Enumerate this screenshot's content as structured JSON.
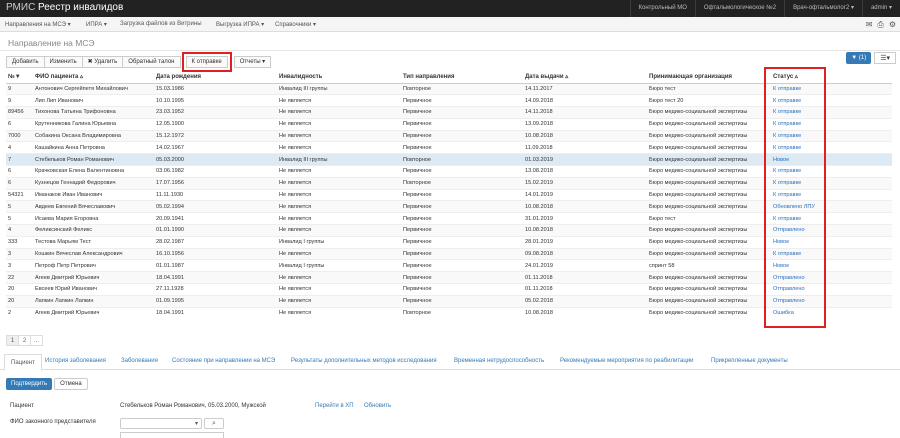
{
  "navbar": {
    "brand": "РМИС",
    "title": "Реестр инвалидов",
    "right_items": [
      "Контрольный МО",
      "Офтальмологическое №2",
      "Врач-офтальмолог2 ▾",
      "admin ▾"
    ]
  },
  "menu": {
    "items": [
      "Направления на МСЭ ▾",
      "ИПРА ▾",
      "Загрузка файлов из Витрины",
      "Выгрузка ИПРА ▾",
      "Справочники ▾"
    ]
  },
  "page_title": "Направление на МСЭ",
  "toolbar": {
    "add": "Добавить",
    "edit": "Изменить",
    "delete": "✖ Удалить",
    "reverse": "Обратный талон",
    "to_send": "К отправке",
    "reports": "Отчеты ▾"
  },
  "filter": {
    "label": "▼ (1)"
  },
  "list_toggle": "☰▾",
  "table": {
    "headers": [
      "№▼",
      "ФИО пациента ▵",
      "Дата рождения",
      "Инвалидность",
      "Тип направления",
      "Дата выдачи ▵",
      "Принимающая организация",
      "Статус ▵"
    ],
    "rows": [
      [
        "9",
        "Антонович Сергейпетя Михайлович",
        "15.03.1986",
        "Инвалид III группы",
        "Повторное",
        "14.11.2017",
        "Бюро тест",
        "К отправке"
      ],
      [
        "9",
        "Лип Лип Иванович",
        "10.10.1995",
        "Не является",
        "Первичное",
        "14.09.2018",
        "Бюро тест 20",
        "К отправке"
      ],
      [
        "89456",
        "Тихонова Татьяна Трифоновна",
        "23.03.1952",
        "Не является",
        "Первичное",
        "14.11.2018",
        "Бюро медико-социальной экспертизы",
        "К отправке"
      ],
      [
        "6",
        "Крутенникова Галина Юрьевна",
        "12.05.1900",
        "Не является",
        "Первичное",
        "13.09.2018",
        "Бюро медико-социальной экспертизы",
        "К отправке"
      ],
      [
        "7000",
        "Собакина Оксана Владимировна",
        "15.12.1972",
        "Не является",
        "Первичное",
        "10.08.2018",
        "Бюро медико-социальной экспертизы",
        "К отправке"
      ],
      [
        "4",
        "Кашайкина Анна Петровна",
        "14.02.1967",
        "Не является",
        "Первичное",
        "11.09.2018",
        "Бюро медико-социальной экспертизы",
        "К отправке"
      ],
      [
        "7",
        "Стебельков Роман Романович",
        "05.03.2000",
        "Инвалид III группы",
        "Повторное",
        "01.03.2019",
        "Бюро медико-социальной экспертизы",
        "Новое"
      ],
      [
        "6",
        "Крачковская Елена Валентиновна",
        "03.06.1982",
        "Не является",
        "Первичное",
        "13.08.2018",
        "Бюро медико-социальной экспертизы",
        "К отправке"
      ],
      [
        "6",
        "Кузнецов Геннадий Федорович",
        "17.07.1956",
        "Не является",
        "Повторное",
        "15.02.2019",
        "Бюро медико-социальной экспертизы",
        "К отправке"
      ],
      [
        "54321",
        "Иманаков Иван Иванович",
        "11.11.1930",
        "Не является",
        "Первичное",
        "14.01.2019",
        "Бюро медико-социальной экспертизы",
        "К отправке"
      ],
      [
        "5",
        "Авдеев Евгений Вячеславович",
        "05.02.1994",
        "Не является",
        "Первичное",
        "10.08.2018",
        "Бюро медико-социальной экспертизы",
        "Обновлено ЛПУ"
      ],
      [
        "5",
        "Исаева Мария Егоровна",
        "20.09.1941",
        "Не является",
        "Первичное",
        "31.01.2019",
        "Бюро тест",
        "К отправке"
      ],
      [
        "4",
        "Феликсинский Феликс",
        "01.01.1990",
        "Не является",
        "Первичное",
        "10.08.2018",
        "Бюро медико-социальной экспертизы",
        "Отправлено"
      ],
      [
        "333",
        "Тестова Марьям Тест",
        "28.02.1987",
        "Инвалид I группы",
        "Первичное",
        "28.01.2019",
        "Бюро медико-социальной экспертизы",
        "Новое"
      ],
      [
        "3",
        "Кошкин Вячеслав Александрович",
        "16.10.1956",
        "Не является",
        "Первичное",
        "09.08.2018",
        "Бюро медико-социальной экспертизы",
        "К отправке"
      ],
      [
        "3",
        "Петроф Петр Петрович",
        "01.01.1987",
        "Инвалид I группы",
        "Первичное",
        "24.01.2019",
        "спринт 58",
        "Новое"
      ],
      [
        "22",
        "Агеев Дмитрий Юрьевич",
        "18.04.1991",
        "Не является",
        "Первичное",
        "01.11.2018",
        "Бюро медико-социальной экспертизы",
        "Отправлено"
      ],
      [
        "20",
        "Евсеев Юрий Иванович",
        "27.11.1928",
        "Не является",
        "Первичное",
        "01.11.2018",
        "Бюро медико-социальной экспертизы",
        "Отправлено"
      ],
      [
        "20",
        "Лапкин Лапкин Лапкин",
        "01.09.1995",
        "Не является",
        "Первичное",
        "05.02.2018",
        "Бюро медико-социальной экспертизы",
        "Отправлено"
      ],
      [
        "2",
        "Агеев Дмитрий Юрьевич",
        "18.04.1991",
        "Не является",
        "Повторное",
        "10.08.2018",
        "Бюро медико-социальной экспертизы",
        "Ошибка"
      ]
    ]
  },
  "pager": {
    "pages": [
      "1",
      "2",
      "..."
    ]
  },
  "tabs": [
    "Пациент",
    "История заболевания",
    "Заболевания",
    "Состояние при направлении на МСЭ",
    "Результаты дополнительных методов исследования",
    "Временная нетрудоспособность",
    "Рекомендуемые мероприятия по реабилитации",
    "Прикрепленные документы"
  ],
  "actions": {
    "confirm": "Подтвердить",
    "cancel": "Отмена"
  },
  "form": {
    "patient_label": "Пациент",
    "patient_value": "Стебельков Роман Романович, 05.03.2000, Мужской",
    "link_hp": "Перейти в ХП",
    "link_update": "Обновить",
    "representative_label": "ФИО законного представителя",
    "representative_caret": "▾",
    "search_glyph": "⌕"
  },
  "icons": {
    "menu_right": [
      "envelope-icon",
      "print-icon",
      "gear-icon"
    ],
    "menu_right_glyphs": [
      "✉",
      "⎙",
      "⚙"
    ]
  },
  "colors": {
    "topbar": "#222222",
    "link": "#337ab7",
    "highlight_box": "#e02020",
    "selected_row": "#dde9f3"
  }
}
